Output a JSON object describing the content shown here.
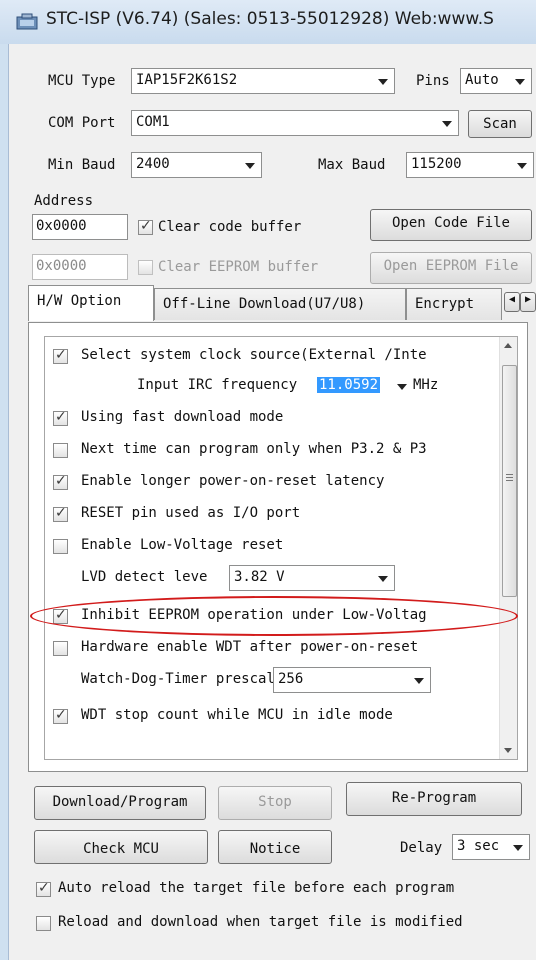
{
  "window": {
    "title": "STC-ISP (V6.74) (Sales: 0513-55012928) Web:www.S"
  },
  "top": {
    "mcu_type_label": "MCU Type",
    "mcu_type_value": "IAP15F2K61S2",
    "pins_label": "Pins",
    "pins_value": "Auto",
    "com_port_label": "COM Port",
    "com_port_value": "COM1",
    "scan_label": "Scan",
    "min_baud_label": "Min Baud",
    "min_baud_value": "2400",
    "max_baud_label": "Max Baud",
    "max_baud_value": "115200",
    "address_label": "Address",
    "address1": "0x0000",
    "clear_code_buffer": "Clear code buffer",
    "open_code_file": "Open Code File",
    "address2": "0x0000",
    "clear_eeprom_buffer": "Clear EEPROM buffer",
    "open_eeprom_file": "Open EEPROM File"
  },
  "tabs": [
    {
      "label": "H/W Option"
    },
    {
      "label": "Off-Line Download(U7/U8)"
    },
    {
      "label": "Encrypt"
    }
  ],
  "options": {
    "sys_clock": "Select system clock source(External /Inte",
    "irc_label": "Input IRC frequency",
    "irc_value": "11.0592",
    "irc_unit": "MHz",
    "fast_download": "Using fast download mode",
    "next_time": "Next time can program only when P3.2 & P3",
    "longer_por": "Enable longer power-on-reset latency",
    "reset_pin": "RESET pin used as I/O port",
    "low_voltage": "Enable Low-Voltage reset",
    "lvd_label": "LVD detect leve",
    "lvd_value": "3.82 V",
    "inhibit_eeprom": "Inhibit EEPROM operation under Low-Voltag",
    "hw_wdt": "Hardware enable WDT after power-on-reset",
    "wdt_label": "Watch-Dog-Timer prescal",
    "wdt_value": "256",
    "wdt_stop": "WDT stop count while MCU in idle mode"
  },
  "bottom": {
    "download": "Download/Program",
    "stop": "Stop",
    "reprogram": "Re-Program",
    "check_mcu": "Check MCU",
    "notice": "Notice",
    "delay_label": "Delay",
    "delay_value": "3 sec",
    "auto_reload": "Auto reload the target file before each program",
    "reload_download": "Reload and download when target file is modified"
  }
}
